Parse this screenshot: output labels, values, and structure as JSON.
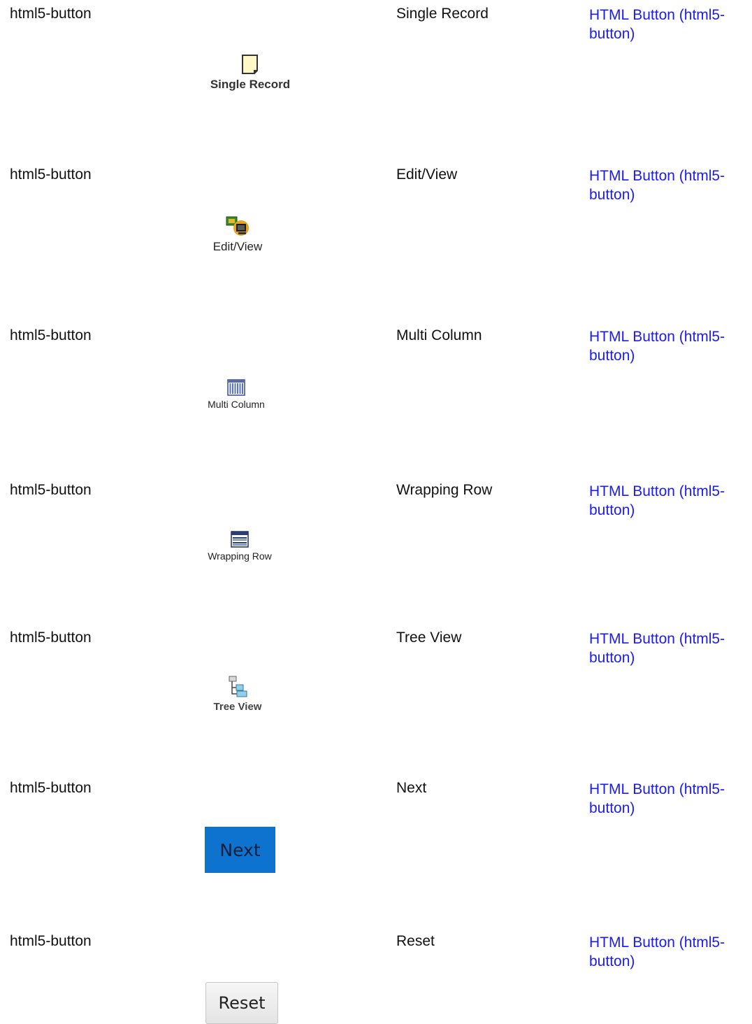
{
  "rows": [
    {
      "type": "html5-button",
      "label": "Single Record",
      "link": [
        "HTML Button (html5-",
        "button)"
      ],
      "caption": "Single Record",
      "icon": "single-record-icon"
    },
    {
      "type": "html5-button",
      "label": "Edit/View",
      "link": [
        "HTML Button (html5-",
        "button)"
      ],
      "caption": "Edit/View",
      "icon": "edit-view-icon"
    },
    {
      "type": "html5-button",
      "label": "Multi Column",
      "link": [
        "HTML Button (html5-",
        "button)"
      ],
      "caption": "Multi Column",
      "icon": "multi-column-icon"
    },
    {
      "type": "html5-button",
      "label": "Wrapping Row",
      "link": [
        "HTML Button (html5-",
        "button)"
      ],
      "caption": "Wrapping Row",
      "icon": "wrapping-row-icon"
    },
    {
      "type": "html5-button",
      "label": "Tree View",
      "link": [
        "HTML Button (html5-",
        "button)"
      ],
      "caption": "Tree View",
      "icon": "tree-view-icon"
    },
    {
      "type": "html5-button",
      "label": "Next",
      "link": [
        "HTML Button (html5-",
        "button)"
      ],
      "caption": "Next",
      "icon": "next-button"
    },
    {
      "type": "html5-button",
      "label": "Reset",
      "link": [
        "HTML Button (html5-",
        "button)"
      ],
      "caption": "Reset",
      "icon": "reset-button"
    }
  ],
  "colors": {
    "link": "#1a1aff",
    "next_button_bg": "#0e73cf",
    "reset_button_bg": "#ececec"
  }
}
